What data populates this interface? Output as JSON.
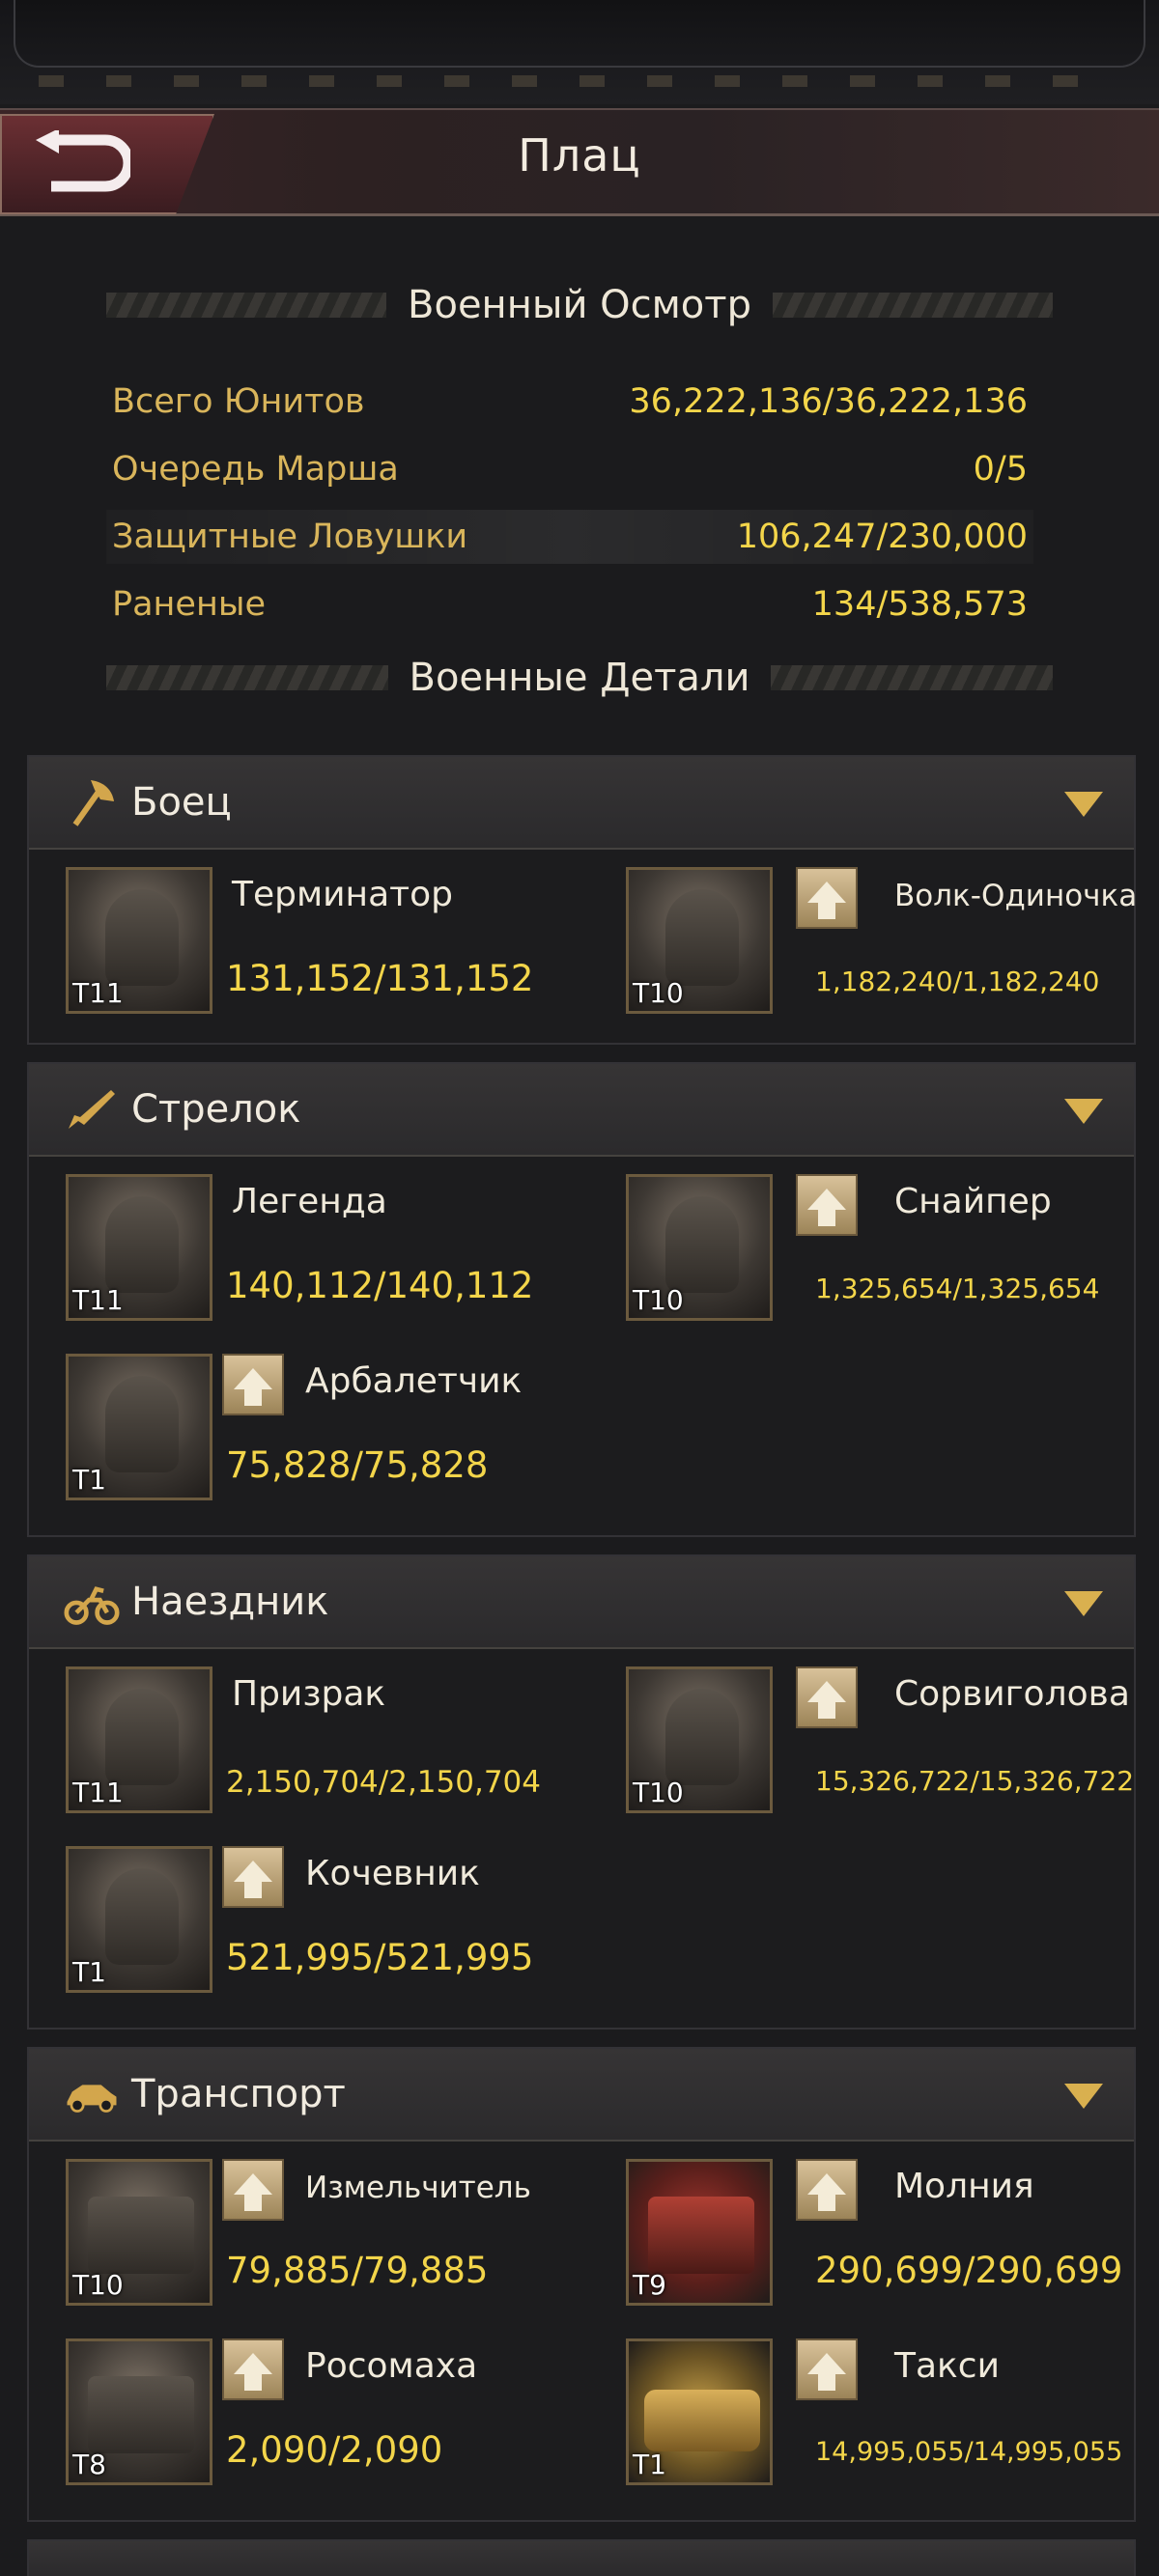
{
  "header": {
    "title": "Плац"
  },
  "review": {
    "heading": "Военный Осмотр",
    "stats": [
      {
        "label": "Всего Юнитов",
        "value": "36,222,136/36,222,136"
      },
      {
        "label": "Очередь Марша",
        "value": "0/5"
      },
      {
        "label": "Защитные Ловушки",
        "value": "106,247/230,000"
      },
      {
        "label": "Раненые",
        "value": "134/538,573"
      }
    ]
  },
  "details": {
    "heading": "Военные Детали"
  },
  "categories": [
    {
      "name": "Боец",
      "icon": "axe-icon",
      "units": [
        {
          "name": "Терминатор",
          "count": "131,152/131,152",
          "tier": "T11"
        },
        {
          "name": "Волк-Одиночка",
          "count": "1,182,240/1,182,240",
          "tier": "T10"
        }
      ]
    },
    {
      "name": "Стрелок",
      "icon": "rifle-icon",
      "units": [
        {
          "name": "Легенда",
          "count": "140,112/140,112",
          "tier": "T11"
        },
        {
          "name": "Снайпер",
          "count": "1,325,654/1,325,654",
          "tier": "T10"
        },
        {
          "name": "Арбалетчик",
          "count": "75,828/75,828",
          "tier": "T1"
        }
      ]
    },
    {
      "name": "Наездник",
      "icon": "motorcycle-icon",
      "units": [
        {
          "name": "Призрак",
          "count": "2,150,704/2,150,704",
          "tier": "T11"
        },
        {
          "name": "Сорвиголова",
          "count": "15,326,722/15,326,722",
          "tier": "T10"
        },
        {
          "name": "Кочевник",
          "count": "521,995/521,995",
          "tier": "T1"
        }
      ]
    },
    {
      "name": "Транспорт",
      "icon": "car-icon",
      "units": [
        {
          "name": "Измельчитель",
          "count": "79,885/79,885",
          "tier": "T10"
        },
        {
          "name": "Молния",
          "count": "290,699/290,699",
          "tier": "T9"
        },
        {
          "name": "Росомаха",
          "count": "2,090/2,090",
          "tier": "T8"
        },
        {
          "name": "Такси",
          "count": "14,995,055/14,995,055",
          "tier": "T1"
        }
      ]
    }
  ]
}
